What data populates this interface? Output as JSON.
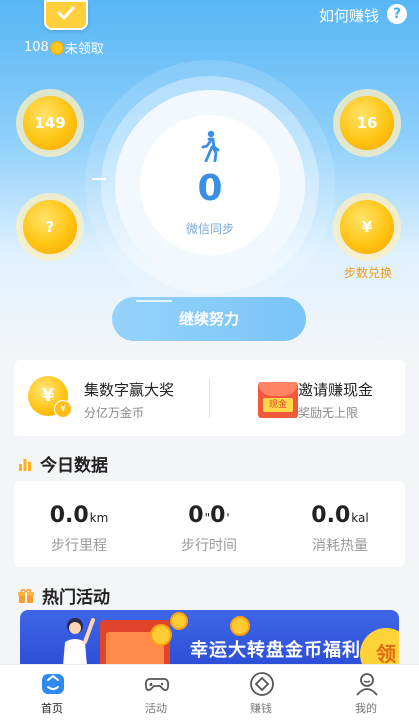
{
  "header": {
    "coins_count": "108",
    "coins_suffix": "未领取",
    "how_earn": "如何赚钱",
    "help": "?"
  },
  "bubbles": {
    "top_left": "149",
    "bottom_left": "?",
    "top_right": "16",
    "bottom_right": "¥",
    "exchange_label": "步数兑换"
  },
  "steps": {
    "count": "0",
    "sync_label": "微信同步"
  },
  "continue_button": "继续努力",
  "promos": [
    {
      "title": "集数字赢大奖",
      "subtitle": "分亿万金币",
      "icon": "coin-icon",
      "icon_text": "¥",
      "badge": "¥"
    },
    {
      "title": "邀请赚现金",
      "subtitle": "奖励无上限",
      "icon": "red-envelope-icon",
      "icon_text": "现金"
    }
  ],
  "today": {
    "title": "今日数据",
    "stats": [
      {
        "value": "0.0",
        "unit": "km",
        "label": "步行里程"
      },
      {
        "value": "0",
        "unit": "\"",
        "value2": "0",
        "unit2": "'",
        "label": "步行时间"
      },
      {
        "value": "0.0",
        "unit": "kal",
        "label": "消耗热量"
      }
    ]
  },
  "hot": {
    "title": "热门活动",
    "banner_text": "幸运大转盘金币福利",
    "banner_badge": "领"
  },
  "tabs": [
    {
      "label": "首页",
      "icon": "home-icon",
      "active": true
    },
    {
      "label": "活动",
      "icon": "gamepad-icon",
      "active": false
    },
    {
      "label": "赚钱",
      "icon": "diamond-icon",
      "active": false
    },
    {
      "label": "我的",
      "icon": "user-icon",
      "active": false
    }
  ],
  "colors": {
    "accent": "#3a8fe3",
    "coin": "#ffc411",
    "exchange": "#f09a14"
  }
}
